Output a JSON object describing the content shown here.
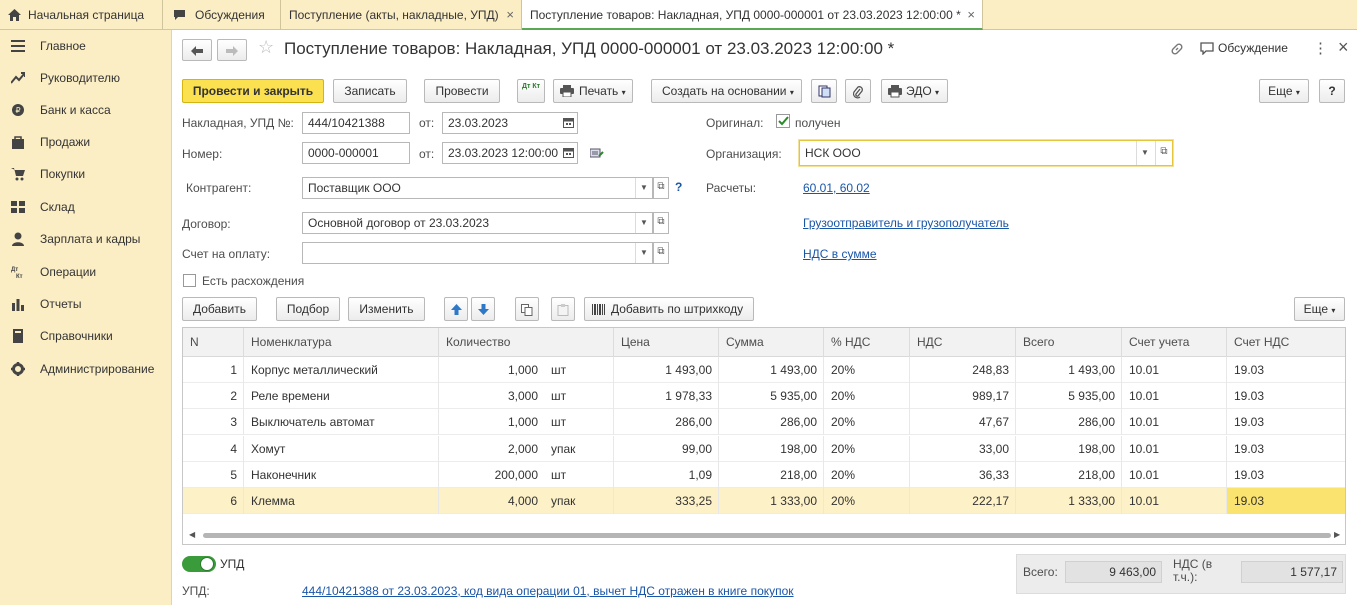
{
  "tabs": {
    "home": "Начальная страница",
    "discussions": "Обсуждения",
    "receipts_list": "Поступление (акты, накладные, УПД)",
    "current": "Поступление товаров: Накладная, УПД 0000-000001 от 23.03.2023 12:00:00 *",
    "close_glyph": "×"
  },
  "sidebar": {
    "items": [
      {
        "label": "Главное",
        "icon": "menu-icon"
      },
      {
        "label": "Руководителю",
        "icon": "chart-trend-icon"
      },
      {
        "label": "Банк и касса",
        "icon": "coin-icon"
      },
      {
        "label": "Продажи",
        "icon": "bag-icon"
      },
      {
        "label": "Покупки",
        "icon": "cart-icon"
      },
      {
        "label": "Склад",
        "icon": "warehouse-icon"
      },
      {
        "label": "Зарплата и кадры",
        "icon": "person-icon"
      },
      {
        "label": "Операции",
        "icon": "dt-kt-icon"
      },
      {
        "label": "Отчеты",
        "icon": "bar-chart-icon"
      },
      {
        "label": "Справочники",
        "icon": "book-icon"
      },
      {
        "label": "Администрирование",
        "icon": "gear-icon"
      }
    ]
  },
  "header": {
    "title": "Поступление товаров: Накладная, УПД 0000-000001 от 23.03.2023 12:00:00 *",
    "discussion": "Обсуждение",
    "star": "☆",
    "more": "⋮",
    "close": "×"
  },
  "toolbar": {
    "post_close": "Провести и закрыть",
    "save": "Записать",
    "post": "Провести",
    "dtkt": "Дт Кт",
    "print": "Печать",
    "create_based": "Создать на основании",
    "edo": "ЭДО",
    "more": "Еще",
    "help": "?"
  },
  "form": {
    "invoice_label": "Накладная, УПД №:",
    "invoice_number": "444/10421388",
    "from_label": "от:",
    "invoice_date": "23.03.2023",
    "number_label": "Номер:",
    "number": "0000-000001",
    "number_date": "23.03.2023 12:00:00",
    "original_label": "Оригинал:",
    "original_value": "получен",
    "org_label": "Организация:",
    "org": "НСК ООО",
    "counterparty_label": "Контрагент:",
    "counterparty": "Поставщик ООО",
    "help_q": "?",
    "settlements_label": "Расчеты:",
    "settlements": "60.01, 60.02",
    "contract_label": "Договор:",
    "contract": "Основной договор от 23.03.2023",
    "shipper_link": "Грузоотправитель и грузополучатель",
    "payment_invoice_label": "Счет на оплату:",
    "payment_invoice": "",
    "vat_link": "НДС в сумме",
    "discrepancy_label": "Есть расхождения"
  },
  "table_toolbar": {
    "add": "Добавить",
    "pick": "Подбор",
    "edit": "Изменить",
    "barcode": "Добавить по штрихкоду",
    "more": "Еще"
  },
  "table": {
    "columns": [
      "N",
      "Номенклатура",
      "Количество",
      "Цена",
      "Сумма",
      "% НДС",
      "НДС",
      "Всего",
      "Счет учета",
      "Счет НДС"
    ],
    "rows": [
      {
        "n": "1",
        "item": "Корпус металлический",
        "qty": "1,000",
        "unit": "шт",
        "price": "1 493,00",
        "sum": "1 493,00",
        "vat_rate": "20%",
        "vat": "248,83",
        "total": "1 493,00",
        "account": "10.01",
        "vat_account": "19.03"
      },
      {
        "n": "2",
        "item": "Реле времени",
        "qty": "3,000",
        "unit": "шт",
        "price": "1 978,33",
        "sum": "5 935,00",
        "vat_rate": "20%",
        "vat": "989,17",
        "total": "5 935,00",
        "account": "10.01",
        "vat_account": "19.03"
      },
      {
        "n": "3",
        "item": "Выключатель автомат",
        "qty": "1,000",
        "unit": "шт",
        "price": "286,00",
        "sum": "286,00",
        "vat_rate": "20%",
        "vat": "47,67",
        "total": "286,00",
        "account": "10.01",
        "vat_account": "19.03"
      },
      {
        "n": "4",
        "item": "Хомут",
        "qty": "2,000",
        "unit": "упак",
        "price": "99,00",
        "sum": "198,00",
        "vat_rate": "20%",
        "vat": "33,00",
        "total": "198,00",
        "account": "10.01",
        "vat_account": "19.03"
      },
      {
        "n": "5",
        "item": "Наконечник",
        "qty": "200,000",
        "unit": "шт",
        "price": "1,09",
        "sum": "218,00",
        "vat_rate": "20%",
        "vat": "36,33",
        "total": "218,00",
        "account": "10.01",
        "vat_account": "19.03"
      },
      {
        "n": "6",
        "item": "Клемма",
        "qty": "4,000",
        "unit": "упак",
        "price": "333,25",
        "sum": "1 333,00",
        "vat_rate": "20%",
        "vat": "222,17",
        "total": "1 333,00",
        "account": "10.01",
        "vat_account": "19.03"
      }
    ]
  },
  "footer": {
    "upd_toggle": "УПД",
    "upd_label": "УПД:",
    "upd_link": "444/10421388 от 23.03.2023, код вида операции 01, вычет НДС отражен в книге покупок",
    "total_label": "Всего:",
    "total": "9 463,00",
    "vat_label": "НДС (в т.ч.):",
    "vat_total": "1 577,17"
  },
  "colors": {
    "accent": "#fbe050",
    "sidebar": "#fbeec5",
    "selected_row": "#fdf1c7",
    "link": "#1a56a8",
    "toggle": "#3a9b3a"
  }
}
